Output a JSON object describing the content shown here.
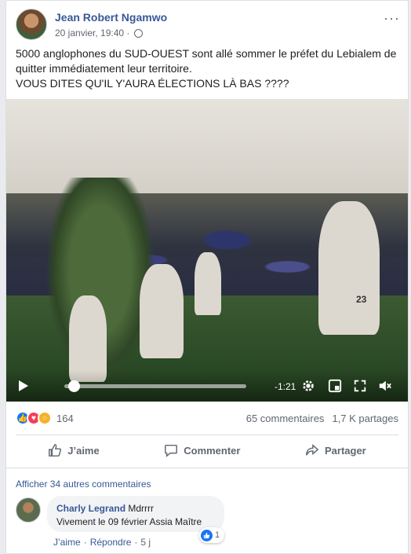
{
  "post": {
    "author": "Jean Robert Ngamwo",
    "timestamp": "20 janvier, 19:40 ·",
    "more_label": "···",
    "text_line1": "5000 anglophones du SUD-OUEST sont allé sommer le préfet du Lebialem de quitter immédiatement leur territoire.",
    "text_line2": "VOUS DITES QU'IL Y'AURA ÉLECTIONS LÀ BAS ????"
  },
  "video": {
    "time_remaining": "-1:21",
    "progress": 0.05,
    "jersey_number": "23"
  },
  "stats": {
    "reaction_count": "164",
    "comments": "65 commentaires",
    "shares": "1,7 K partages",
    "reaction_colors": {
      "like": "#1877f2",
      "love": "#f33e58",
      "wow": "#f7b125"
    }
  },
  "actions": {
    "like": "J’aime",
    "comment": "Commenter",
    "share": "Partager"
  },
  "comments": {
    "more_label": "Afficher 34 autres commentaires",
    "item": {
      "author": "Charly Legrand",
      "text_first": "Mdrrrr",
      "text_second": "Vivement le 09 février Assia Maître",
      "reaction_count": "1",
      "like_label": "J’aime",
      "reply_label": "Répondre",
      "age": "5 j",
      "dot": "·"
    }
  }
}
